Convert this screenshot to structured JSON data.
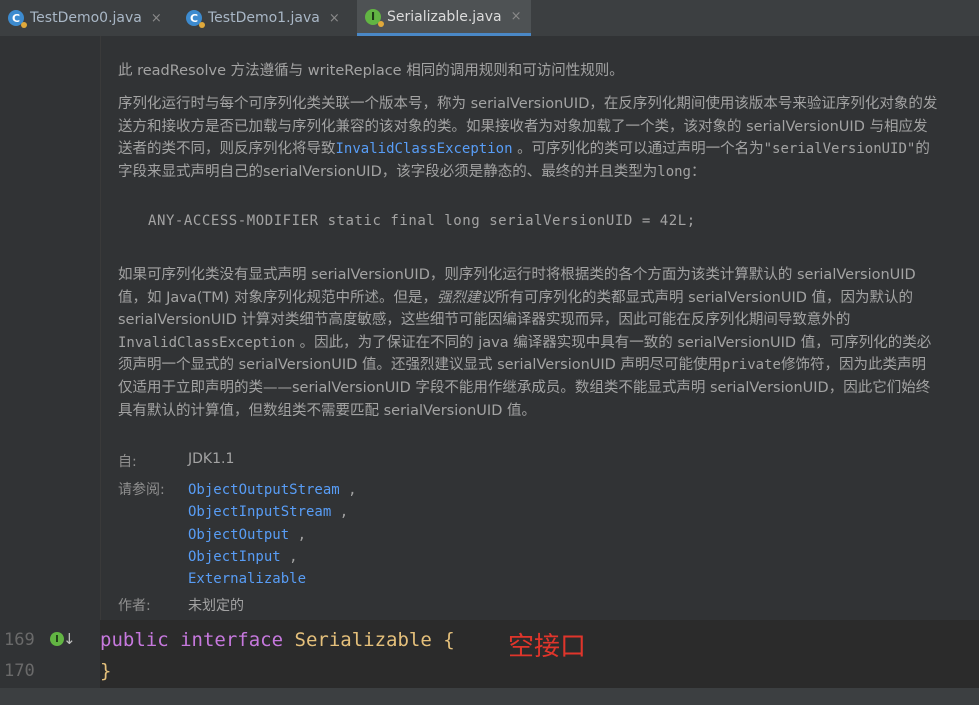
{
  "tabs": [
    {
      "label": "TestDemo0.java",
      "icon": "class-icon",
      "active": false
    },
    {
      "label": "TestDemo1.java",
      "icon": "class-icon",
      "active": false
    },
    {
      "label": "Serializable.java",
      "icon": "interface-icon",
      "active": true
    }
  ],
  "tab_close_glyph": "×",
  "doc": {
    "p1": "此 readResolve 方法遵循与 writeReplace 相同的调用规则和可访问性规则。",
    "p2_a": "序列化运行时与每个可序列化类关联一个版本号，称为 serialVersionUID，在反序列化期间使用该版本号来验证序列化对象的发送方和接收方是否已加载与序列化兼容的该对象的类。如果接收者为对象加载了一个类，该对象的 serialVersionUID 与相应发送者的类不同，则反序列化将导致",
    "p2_link": "InvalidClassException",
    "p2_b": " 。可序列化的类可以通过声明一个名为",
    "p2_mono": "\"serialVersionUID\"",
    "p2_c": "的字段来显式声明自己的serialVersionUID，该字段必须是静态的、最终的并且类型为",
    "p2_mono2": "long",
    "p2_d": "：",
    "code": "ANY-ACCESS-MODIFIER static final long serialVersionUID = 42L;",
    "p3_a": "如果可序列化类没有显式声明 serialVersionUID，则序列化运行时将根据类的各个方面为该类计算默认的 serialVersionUID 值，如 Java(TM) 对象序列化规范中所述。但是，",
    "p3_em": "强烈建议",
    "p3_b": "所有可序列化的类都显式声明 serialVersionUID 值，因为默认的 serialVersionUID 计算对类细节高度敏感，这些细节可能因编译器实现而异，因此可能在反序列化期间导致意外的",
    "p3_mono": "InvalidClassException",
    "p3_c": " 。因此，为了保证在不同的 java 编译器实现中具有一致的 serialVersionUID 值，可序列化的类必须声明一个显式的 serialVersionUID 值。还强烈建议显式 serialVersionUID 声明尽可能使用",
    "p3_mono2": "private",
    "p3_d": "修饰符，因为此类声明仅适用于立即声明的类——serialVersionUID 字段不能用作继承成员。数组类不能显式声明 serialVersionUID，因此它们始终具有默认的计算值，但数组类不需要匹配 serialVersionUID 值。",
    "since_label": "自:",
    "since_value": "JDK1.1",
    "see_label": "请参阅:",
    "see_also": [
      "ObjectOutputStream",
      "ObjectInputStream",
      "ObjectOutput",
      "ObjectInput",
      "Externalizable"
    ],
    "author_label": "作者:",
    "author_value": "未划定的"
  },
  "editor": {
    "line169_num": "169",
    "line170_num": "170",
    "kw_public": "public",
    "kw_interface": "interface",
    "name": "Serializable",
    "open_brace": "{",
    "close_brace": "}",
    "annotation": "空接口"
  },
  "colors": {
    "link": "#589df6",
    "annotation": "#e0352b",
    "active_tab_underline": "#4a88c7"
  }
}
